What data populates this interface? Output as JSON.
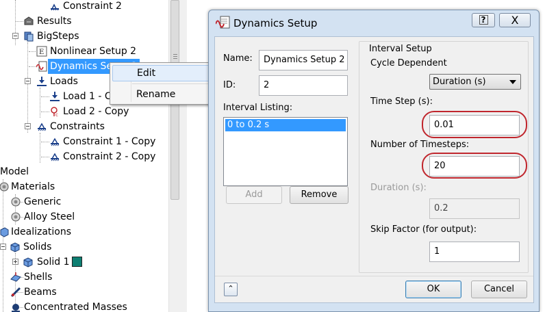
{
  "tree": {
    "nodes": [
      {
        "label": "Constraint 2",
        "icon": "constraint-icon"
      },
      {
        "label": "Results",
        "icon": "results-icon"
      },
      {
        "label": "BigSteps",
        "icon": "analysis-icon"
      },
      {
        "label": "Nonlinear Setup 2",
        "icon": "setup-icon"
      },
      {
        "label": "Dynamics Setup 2",
        "icon": "dynamics-icon",
        "selected": true
      },
      {
        "label": "Loads",
        "icon": "loads-icon"
      },
      {
        "label": "Load 1 - Copy",
        "icon": "load-icon"
      },
      {
        "label": "Load 2 - Copy",
        "icon": "load-icon"
      },
      {
        "label": "Constraints",
        "icon": "constraints-icon"
      },
      {
        "label": "Constraint 1 - Copy",
        "icon": "constraint-icon"
      },
      {
        "label": "Constraint 2 - Copy",
        "icon": "constraint-icon"
      },
      {
        "label": "Model",
        "icon": ""
      },
      {
        "label": "Materials",
        "icon": "materials-icon"
      },
      {
        "label": "Generic",
        "icon": "material-icon"
      },
      {
        "label": "Alloy Steel",
        "icon": "material-icon"
      },
      {
        "label": "Idealizations",
        "icon": "idealizations-icon"
      },
      {
        "label": "Solids",
        "icon": "solids-icon"
      },
      {
        "label": "Solid 1",
        "icon": "solid-icon",
        "swatch": "#0e7f72"
      },
      {
        "label": "Shells",
        "icon": "shells-icon"
      },
      {
        "label": "Beams",
        "icon": "beams-icon"
      },
      {
        "label": "Concentrated Masses",
        "icon": "masses-icon"
      }
    ]
  },
  "context_menu": {
    "items": [
      {
        "label": "Edit",
        "highlighted": true
      },
      {
        "label": "Rename",
        "highlighted": false
      }
    ]
  },
  "dialog": {
    "title": "Dynamics Setup",
    "help_label": "?",
    "close_label": "X",
    "name_label": "Name:",
    "name_value": "Dynamics Setup 2",
    "id_label": "ID:",
    "id_value": "2",
    "interval_listing_label": "Interval Listing:",
    "interval_items": [
      "0 to 0.2 s"
    ],
    "add_label": "Add",
    "remove_label": "Remove",
    "interval_setup": {
      "title": "Interval Setup",
      "cycle_label": "Cycle Dependent",
      "cycle_value": "Duration (s)",
      "time_step_label": "Time Step (s):",
      "time_step_value": "0.01",
      "num_timesteps_label": "Number of Timesteps:",
      "num_timesteps_value": "20",
      "duration_label": "Duration (s):",
      "duration_value": "0.2",
      "skip_label": "Skip Factor (for output):",
      "skip_value": "1"
    },
    "collapse_label": "⌃",
    "ok_label": "OK",
    "cancel_label": "Cancel"
  },
  "colors": {
    "selection": "#3399ff",
    "highlight_ring": "#c0262d",
    "dialog_frame": "#d3e2f2"
  }
}
